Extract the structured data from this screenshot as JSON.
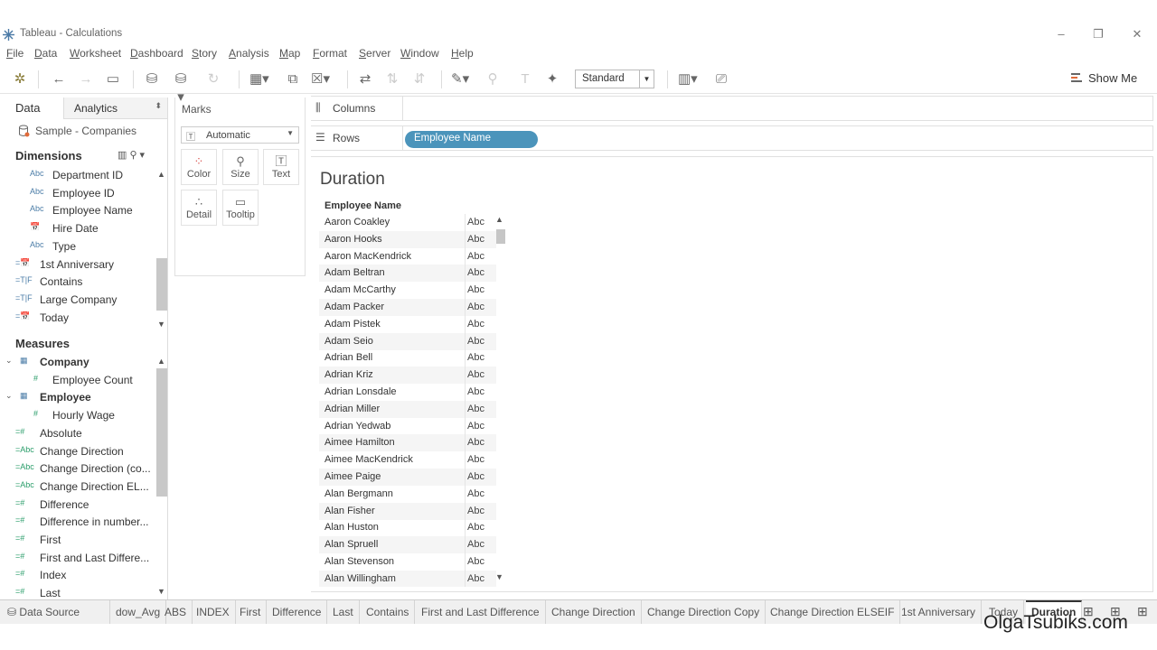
{
  "window": {
    "title": "Tableau - Calculations",
    "controls": [
      "–",
      "❐",
      "✕"
    ]
  },
  "menu": [
    "File",
    "Data",
    "Worksheet",
    "Dashboard",
    "Story",
    "Analysis",
    "Map",
    "Format",
    "Server",
    "Window",
    "Help"
  ],
  "toolbar": {
    "fit_select": "Standard",
    "show_me_label": "Show Me",
    "icons": [
      "tableau-logo-icon",
      "undo-icon",
      "redo-icon",
      "save-icon",
      "new-datasource-icon",
      "pause-updates-icon",
      "refresh-icon",
      "new-worksheet-icon",
      "duplicate-sheet-icon",
      "clear-sheet-icon",
      "swap-icon",
      "sort-ascending-icon",
      "sort-descending-icon",
      "highlight-icon",
      "group-icon",
      "labels-icon",
      "pin-icon",
      "present-cards-icon",
      "presentation-mode-icon"
    ]
  },
  "data_pane": {
    "tab_data": "Data",
    "tab_analytics": "Analytics",
    "datasource": "Sample - Companies",
    "dimensions_title": "Dimensions",
    "dimensions": [
      {
        "type": "Abc",
        "label": "Department ID",
        "indent": 1
      },
      {
        "type": "Abc",
        "label": "Employee ID",
        "indent": 1
      },
      {
        "type": "Abc",
        "label": "Employee Name",
        "indent": 1
      },
      {
        "type": "📅",
        "label": "Hire Date",
        "indent": 1
      },
      {
        "type": "Abc",
        "label": "Type",
        "indent": 1
      },
      {
        "type": "=📅",
        "label": "1st Anniversary",
        "indent": 0
      },
      {
        "type": "=T|F",
        "label": "Contains",
        "indent": 0
      },
      {
        "type": "=T|F",
        "label": "Large Company",
        "indent": 0
      },
      {
        "type": "=📅",
        "label": "Today",
        "indent": 0
      }
    ],
    "measures_title": "Measures",
    "measures": [
      {
        "type": "▦",
        "label": "Company",
        "group": true
      },
      {
        "type": "#",
        "label": "Employee Count",
        "indent": 1
      },
      {
        "type": "▦",
        "label": "Employee",
        "group": true
      },
      {
        "type": "#",
        "label": "Hourly Wage",
        "indent": 1
      },
      {
        "type": "=#",
        "label": "Absolute",
        "indent": 0
      },
      {
        "type": "=Abc",
        "label": "Change Direction",
        "indent": 0
      },
      {
        "type": "=Abc",
        "label": "Change Direction (co...",
        "indent": 0
      },
      {
        "type": "=Abc",
        "label": "Change Direction EL...",
        "indent": 0
      },
      {
        "type": "=#",
        "label": "Difference",
        "indent": 0
      },
      {
        "type": "=#",
        "label": "Difference in number...",
        "indent": 0
      },
      {
        "type": "=#",
        "label": "First",
        "indent": 0
      },
      {
        "type": "=#",
        "label": "First and Last Differe...",
        "indent": 0
      },
      {
        "type": "=#",
        "label": "Index",
        "indent": 0
      },
      {
        "type": "=#",
        "label": "Last",
        "indent": 0
      }
    ]
  },
  "marks": {
    "title": "Marks",
    "type": "Automatic",
    "buttons": [
      {
        "label": "Color",
        "icon": "color-icon"
      },
      {
        "label": "Size",
        "icon": "size-icon"
      },
      {
        "label": "Text",
        "icon": "text-icon"
      },
      {
        "label": "Detail",
        "icon": "detail-icon"
      },
      {
        "label": "Tooltip",
        "icon": "tooltip-icon"
      }
    ]
  },
  "shelves": {
    "columns_label": "Columns",
    "rows_label": "Rows",
    "rows_pill": "Employee Name"
  },
  "view": {
    "title": "Duration",
    "column_header": "Employee Name",
    "cell_value": "Abc",
    "rows": [
      "Aaron Coakley",
      "Aaron Hooks",
      "Aaron MacKendrick",
      "Adam Beltran",
      "Adam McCarthy",
      "Adam Packer",
      "Adam Pistek",
      "Adam Seio",
      "Adrian Bell",
      "Adrian Kriz",
      "Adrian Lonsdale",
      "Adrian Miller",
      "Adrian Yedwab",
      "Aimee Hamilton",
      "Aimee MacKendrick",
      "Aimee Paige",
      "Alan Bergmann",
      "Alan Fisher",
      "Alan Huston",
      "Alan Spruell",
      "Alan Stevenson",
      "Alan Willingham"
    ]
  },
  "sheet_tabs": {
    "data_source": "Data Source",
    "tabs": [
      "dow_Avg",
      "ABS",
      "INDEX",
      "First",
      "Difference",
      "Last",
      "Contains",
      "First and Last Difference",
      "Change Direction",
      "Change Direction Copy",
      "Change Direction ELSEIF",
      "1st Anniversary",
      "Today",
      "Duration"
    ],
    "active": "Duration"
  },
  "watermark": "OlgaTsubiks.com"
}
